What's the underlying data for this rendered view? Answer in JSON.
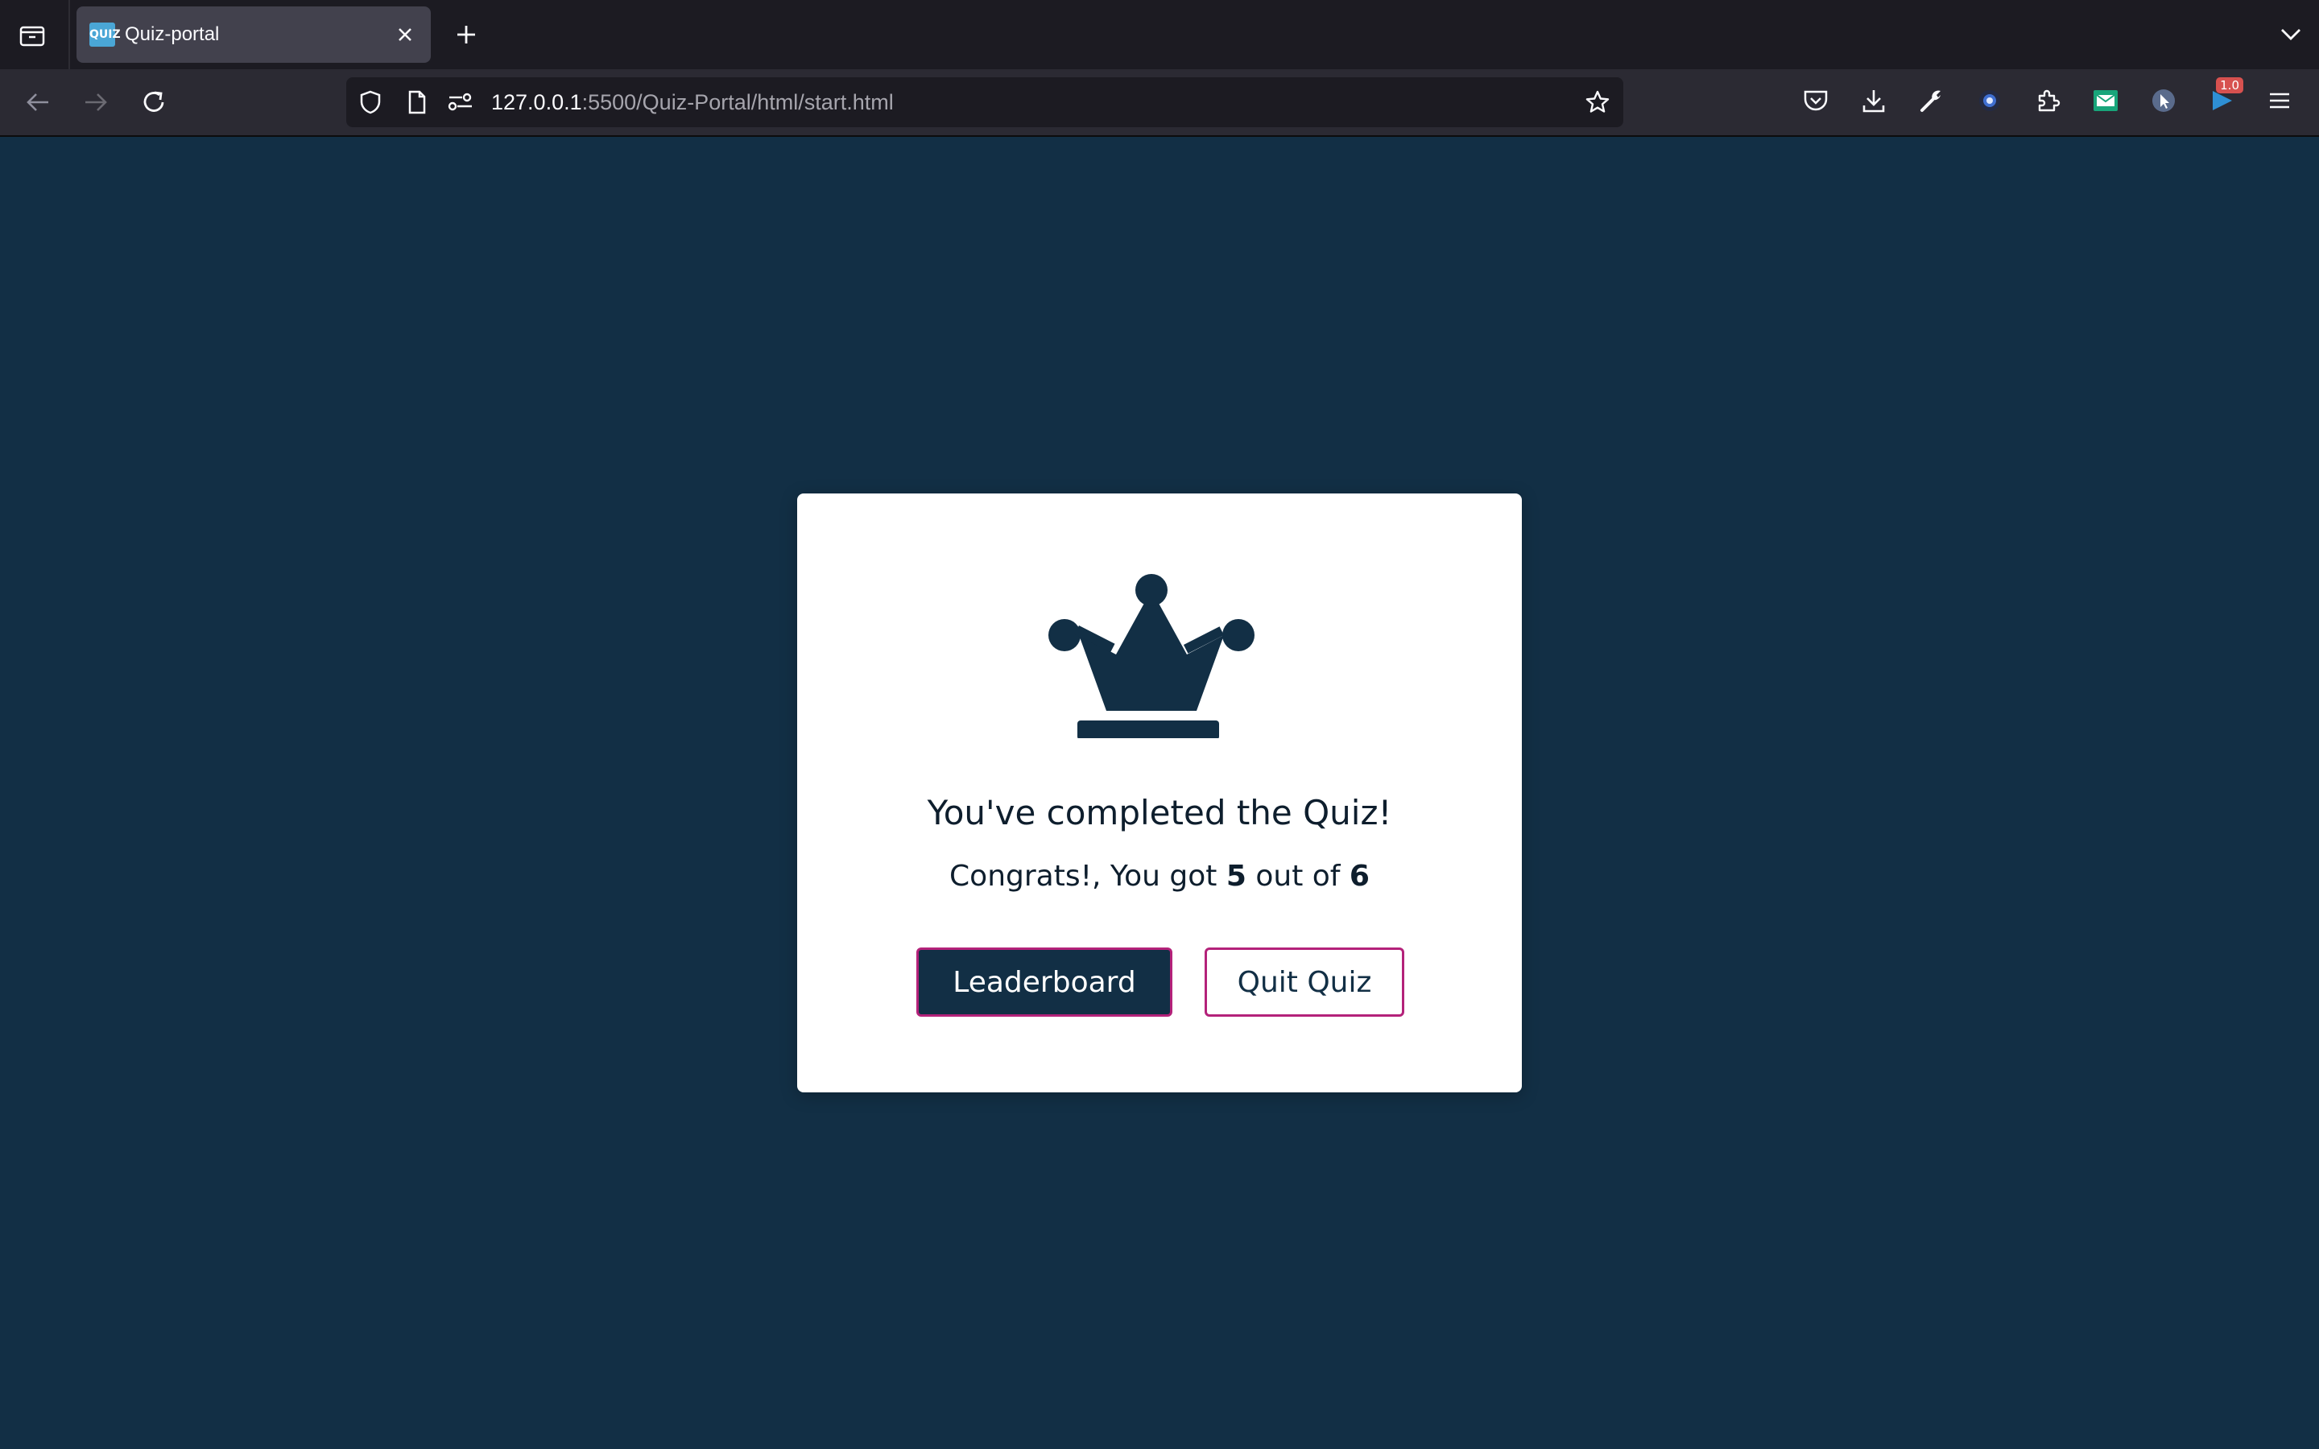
{
  "browser": {
    "tab": {
      "title": "Quiz-portal",
      "favicon_text": "QUIZ"
    },
    "url": {
      "host": "127.0.0.1",
      "rest": ":5500/Quiz-Portal/html/start.html"
    },
    "extension_badge": "1.0",
    "icons": {
      "tab_overview": "tab-overview-icon",
      "close": "close-icon",
      "new_tab": "plus-icon",
      "list_tabs": "chevron-down-icon",
      "back": "arrow-left-icon",
      "forward": "arrow-right-icon",
      "reload": "reload-icon",
      "shield": "shield-icon",
      "page": "page-icon",
      "permissions": "permissions-icon",
      "bookmark": "star-icon",
      "pocket": "pocket-icon",
      "downloads": "download-icon",
      "devtools": "wrench-icon",
      "extensions": "puzzle-icon",
      "menu": "hamburger-icon"
    }
  },
  "result": {
    "title": "You've completed the Quiz!",
    "congrats_prefix": "Congrats!, You got ",
    "score": "5",
    "out_of_text": " out of ",
    "total": "6",
    "leaderboard_label": "Leaderboard",
    "quit_label": "Quit Quiz",
    "icon": "crown-icon"
  },
  "colors": {
    "page_background": "#122f45",
    "accent_border": "#b4227a",
    "card": "#ffffff",
    "text": "#0e1e2d"
  }
}
